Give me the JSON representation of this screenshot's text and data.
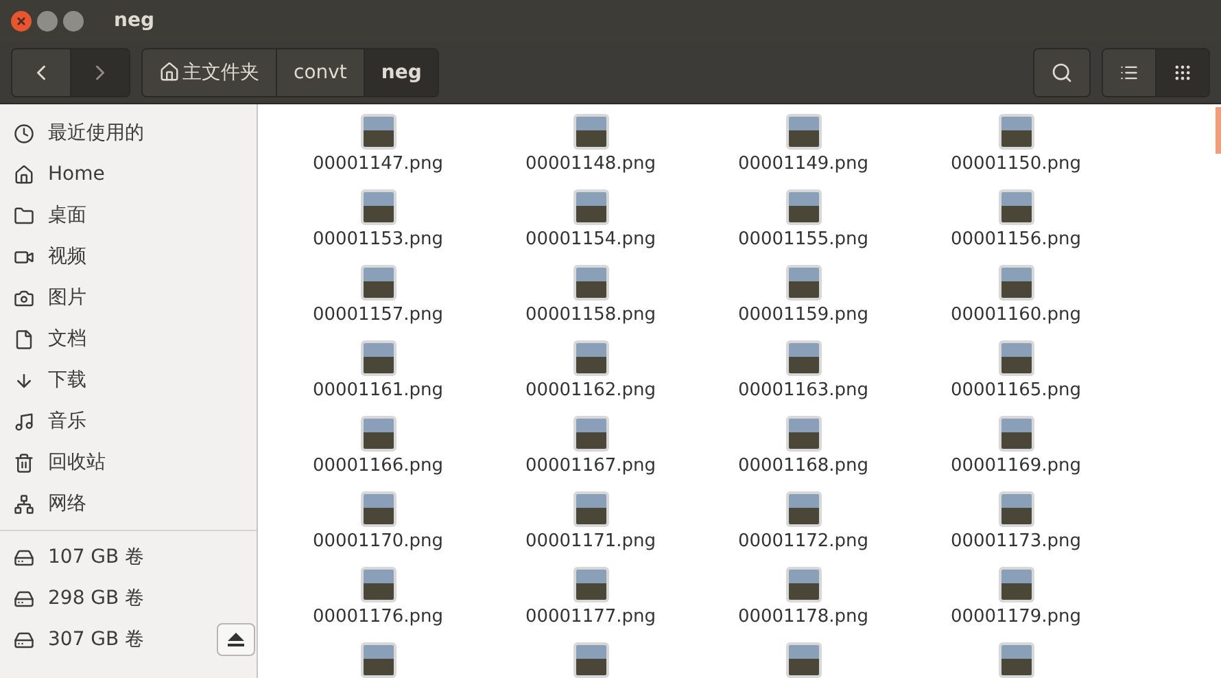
{
  "window": {
    "title": "neg"
  },
  "toolbar": {
    "breadcrumbs": [
      {
        "label": "主文件夹",
        "kind": "home",
        "selected": false
      },
      {
        "label": "convt",
        "kind": "folder",
        "selected": false
      },
      {
        "label": "neg",
        "kind": "folder",
        "selected": true
      }
    ],
    "views": [
      {
        "kind": "list",
        "selected": false
      },
      {
        "kind": "grid",
        "selected": true
      }
    ]
  },
  "sidebar": {
    "places": [
      {
        "label": "最近使用的",
        "kind": "recent"
      },
      {
        "label": "Home",
        "kind": "home"
      },
      {
        "label": "桌面",
        "kind": "desktop"
      },
      {
        "label": "视频",
        "kind": "video"
      },
      {
        "label": "图片",
        "kind": "pictures"
      },
      {
        "label": "文档",
        "kind": "document"
      },
      {
        "label": "下载",
        "kind": "download"
      },
      {
        "label": "音乐",
        "kind": "music"
      },
      {
        "label": "回收站",
        "kind": "trash"
      },
      {
        "label": "网络",
        "kind": "network"
      }
    ],
    "devices": [
      {
        "label": "107 GB 卷",
        "ejectable": false
      },
      {
        "label": "298 GB 卷",
        "ejectable": false
      },
      {
        "label": "307 GB 卷",
        "ejectable": true
      }
    ]
  },
  "files": [
    {
      "name": "00001147.png"
    },
    {
      "name": "00001148.png"
    },
    {
      "name": "00001149.png"
    },
    {
      "name": "00001150.png"
    },
    {
      "name": "00001153.png"
    },
    {
      "name": "00001154.png"
    },
    {
      "name": "00001155.png"
    },
    {
      "name": "00001156.png"
    },
    {
      "name": "00001157.png"
    },
    {
      "name": "00001158.png"
    },
    {
      "name": "00001159.png"
    },
    {
      "name": "00001160.png"
    },
    {
      "name": "00001161.png"
    },
    {
      "name": "00001162.png"
    },
    {
      "name": "00001163.png"
    },
    {
      "name": "00001165.png"
    },
    {
      "name": "00001166.png"
    },
    {
      "name": "00001167.png"
    },
    {
      "name": "00001168.png"
    },
    {
      "name": "00001169.png"
    },
    {
      "name": "00001170.png"
    },
    {
      "name": "00001171.png"
    },
    {
      "name": "00001172.png"
    },
    {
      "name": "00001173.png"
    },
    {
      "name": "00001176.png"
    },
    {
      "name": "00001177.png"
    },
    {
      "name": "00001178.png"
    },
    {
      "name": "00001179.png"
    },
    {
      "kind": "cut"
    },
    {
      "kind": "cut"
    },
    {
      "kind": "cut"
    },
    {
      "kind": "cut"
    }
  ]
}
